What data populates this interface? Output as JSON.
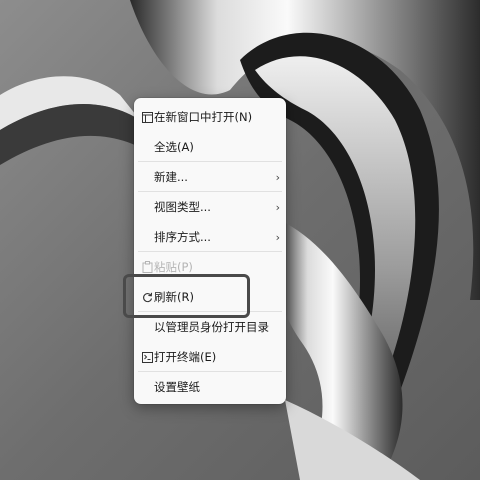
{
  "context_menu": {
    "items": [
      {
        "label": "在新窗口中打开(N)",
        "icon": "new-window-icon"
      },
      {
        "label": "全选(A)"
      },
      {
        "label": "新建...",
        "submenu": true
      },
      {
        "label": "视图类型...",
        "submenu": true
      },
      {
        "label": "排序方式...",
        "submenu": true
      },
      {
        "label": "粘贴(P)",
        "icon": "paste-icon",
        "disabled": true
      },
      {
        "label": "刷新(R)",
        "icon": "refresh-icon"
      },
      {
        "label": "以管理员身份打开目录"
      },
      {
        "label": "打开终端(E)",
        "icon": "terminal-icon"
      },
      {
        "label": "设置壁纸"
      }
    ],
    "chevron": "›"
  },
  "highlight_color": "#4a4a4a"
}
